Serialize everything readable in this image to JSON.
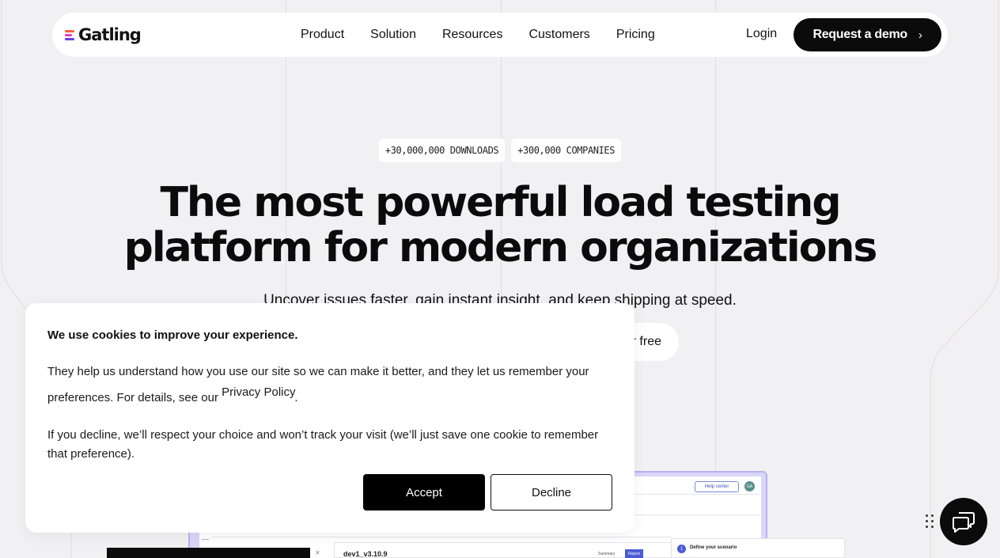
{
  "nav": {
    "logo_text": "Gatling",
    "links": [
      "Product",
      "Solution",
      "Resources",
      "Customers",
      "Pricing"
    ],
    "login_label": "Login",
    "demo_label": "Request a demo",
    "demo_chevron": "›"
  },
  "hero": {
    "badges": [
      "+30,000,000 DOWNLOADS",
      "+300,000 COMPANIES"
    ],
    "title_line1": "The most powerful load testing",
    "title_line2": "platform for modern organizations",
    "subtitle": "Uncover issues faster, gain instant insight, and keep shipping at speed.",
    "cta_visible_text": "r free"
  },
  "mockup": {
    "help_label": "Help center",
    "avatar_initials": "GA",
    "version_label": "dev1_v3.10.9",
    "tabs": [
      "Summary",
      "Report"
    ],
    "step_number": "1",
    "step_label": "Define your scenario"
  },
  "cookie": {
    "title": "We use cookies to improve your experience.",
    "p1_text": "They help us understand how you use our site so we can make it better, and they let us remember your preferences. For details, see our",
    "privacy_link": "Privacy Policy",
    "p1_end": ".",
    "p2_text": "If you decline, we’ll respect your choice and won’t track your visit (we’ll just save one cookie to remember that preference).",
    "accept_label": "Accept",
    "decline_label": "Decline"
  },
  "colors": {
    "background": "#f1f1f3",
    "primary_dark": "#0b0b0b",
    "logo_gradient": [
      "#ff5f3d",
      "#e63fbd",
      "#6a3de8"
    ],
    "mockup_accent": "#b8b3ef"
  },
  "icons": {
    "chat": "chat-bubbles-icon",
    "drag": "drag-handle-icon",
    "chevron": "chevron-right-icon"
  }
}
